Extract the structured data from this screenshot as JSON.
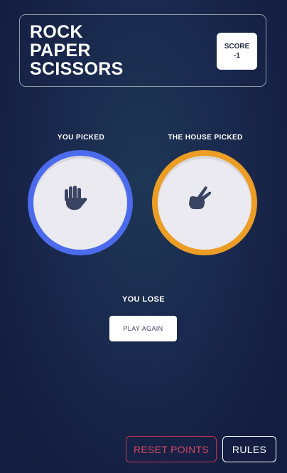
{
  "header": {
    "title_lines": [
      "ROCK",
      "PAPER",
      "SCISSORS"
    ],
    "score_label": "SCORE",
    "score_value": "-1"
  },
  "game": {
    "you_label": "YOU PICKED",
    "house_label": "THE HOUSE PICKED",
    "you_pick": "paper",
    "house_pick": "scissors",
    "result": "YOU LOSE",
    "play_again_label": "PLAY AGAIN"
  },
  "footer": {
    "reset_label": "RESET POINTS",
    "rules_label": "RULES"
  },
  "icons": {
    "you_pick_icon": "paper-hand-icon",
    "house_pick_icon": "scissors-hand-icon"
  },
  "colors": {
    "paper": "#4c6bec",
    "scissors": "#eb9d25",
    "reset": "#d6485f",
    "icon_dark": "#3b4363"
  }
}
